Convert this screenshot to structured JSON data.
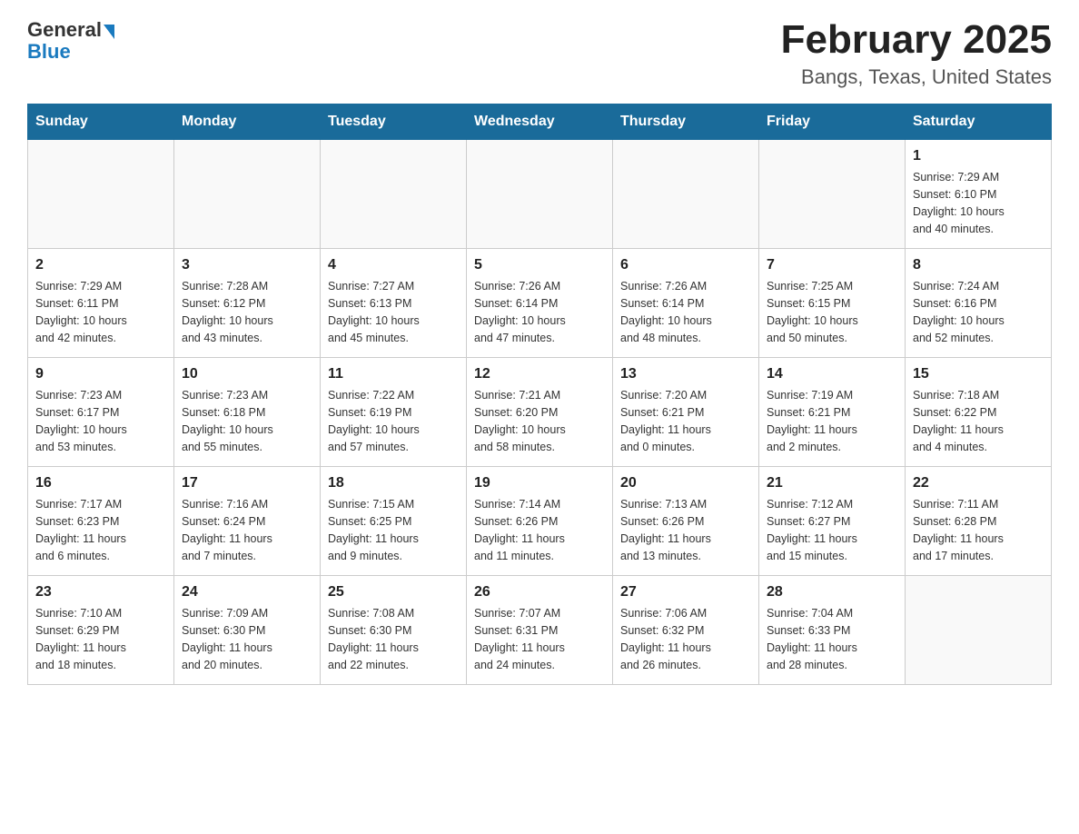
{
  "header": {
    "logo_general": "General",
    "logo_blue": "Blue",
    "month_title": "February 2025",
    "location": "Bangs, Texas, United States"
  },
  "days_of_week": [
    "Sunday",
    "Monday",
    "Tuesday",
    "Wednesday",
    "Thursday",
    "Friday",
    "Saturday"
  ],
  "weeks": [
    {
      "days": [
        {
          "number": "",
          "info": ""
        },
        {
          "number": "",
          "info": ""
        },
        {
          "number": "",
          "info": ""
        },
        {
          "number": "",
          "info": ""
        },
        {
          "number": "",
          "info": ""
        },
        {
          "number": "",
          "info": ""
        },
        {
          "number": "1",
          "info": "Sunrise: 7:29 AM\nSunset: 6:10 PM\nDaylight: 10 hours\nand 40 minutes."
        }
      ]
    },
    {
      "days": [
        {
          "number": "2",
          "info": "Sunrise: 7:29 AM\nSunset: 6:11 PM\nDaylight: 10 hours\nand 42 minutes."
        },
        {
          "number": "3",
          "info": "Sunrise: 7:28 AM\nSunset: 6:12 PM\nDaylight: 10 hours\nand 43 minutes."
        },
        {
          "number": "4",
          "info": "Sunrise: 7:27 AM\nSunset: 6:13 PM\nDaylight: 10 hours\nand 45 minutes."
        },
        {
          "number": "5",
          "info": "Sunrise: 7:26 AM\nSunset: 6:14 PM\nDaylight: 10 hours\nand 47 minutes."
        },
        {
          "number": "6",
          "info": "Sunrise: 7:26 AM\nSunset: 6:14 PM\nDaylight: 10 hours\nand 48 minutes."
        },
        {
          "number": "7",
          "info": "Sunrise: 7:25 AM\nSunset: 6:15 PM\nDaylight: 10 hours\nand 50 minutes."
        },
        {
          "number": "8",
          "info": "Sunrise: 7:24 AM\nSunset: 6:16 PM\nDaylight: 10 hours\nand 52 minutes."
        }
      ]
    },
    {
      "days": [
        {
          "number": "9",
          "info": "Sunrise: 7:23 AM\nSunset: 6:17 PM\nDaylight: 10 hours\nand 53 minutes."
        },
        {
          "number": "10",
          "info": "Sunrise: 7:23 AM\nSunset: 6:18 PM\nDaylight: 10 hours\nand 55 minutes."
        },
        {
          "number": "11",
          "info": "Sunrise: 7:22 AM\nSunset: 6:19 PM\nDaylight: 10 hours\nand 57 minutes."
        },
        {
          "number": "12",
          "info": "Sunrise: 7:21 AM\nSunset: 6:20 PM\nDaylight: 10 hours\nand 58 minutes."
        },
        {
          "number": "13",
          "info": "Sunrise: 7:20 AM\nSunset: 6:21 PM\nDaylight: 11 hours\nand 0 minutes."
        },
        {
          "number": "14",
          "info": "Sunrise: 7:19 AM\nSunset: 6:21 PM\nDaylight: 11 hours\nand 2 minutes."
        },
        {
          "number": "15",
          "info": "Sunrise: 7:18 AM\nSunset: 6:22 PM\nDaylight: 11 hours\nand 4 minutes."
        }
      ]
    },
    {
      "days": [
        {
          "number": "16",
          "info": "Sunrise: 7:17 AM\nSunset: 6:23 PM\nDaylight: 11 hours\nand 6 minutes."
        },
        {
          "number": "17",
          "info": "Sunrise: 7:16 AM\nSunset: 6:24 PM\nDaylight: 11 hours\nand 7 minutes."
        },
        {
          "number": "18",
          "info": "Sunrise: 7:15 AM\nSunset: 6:25 PM\nDaylight: 11 hours\nand 9 minutes."
        },
        {
          "number": "19",
          "info": "Sunrise: 7:14 AM\nSunset: 6:26 PM\nDaylight: 11 hours\nand 11 minutes."
        },
        {
          "number": "20",
          "info": "Sunrise: 7:13 AM\nSunset: 6:26 PM\nDaylight: 11 hours\nand 13 minutes."
        },
        {
          "number": "21",
          "info": "Sunrise: 7:12 AM\nSunset: 6:27 PM\nDaylight: 11 hours\nand 15 minutes."
        },
        {
          "number": "22",
          "info": "Sunrise: 7:11 AM\nSunset: 6:28 PM\nDaylight: 11 hours\nand 17 minutes."
        }
      ]
    },
    {
      "days": [
        {
          "number": "23",
          "info": "Sunrise: 7:10 AM\nSunset: 6:29 PM\nDaylight: 11 hours\nand 18 minutes."
        },
        {
          "number": "24",
          "info": "Sunrise: 7:09 AM\nSunset: 6:30 PM\nDaylight: 11 hours\nand 20 minutes."
        },
        {
          "number": "25",
          "info": "Sunrise: 7:08 AM\nSunset: 6:30 PM\nDaylight: 11 hours\nand 22 minutes."
        },
        {
          "number": "26",
          "info": "Sunrise: 7:07 AM\nSunset: 6:31 PM\nDaylight: 11 hours\nand 24 minutes."
        },
        {
          "number": "27",
          "info": "Sunrise: 7:06 AM\nSunset: 6:32 PM\nDaylight: 11 hours\nand 26 minutes."
        },
        {
          "number": "28",
          "info": "Sunrise: 7:04 AM\nSunset: 6:33 PM\nDaylight: 11 hours\nand 28 minutes."
        },
        {
          "number": "",
          "info": ""
        }
      ]
    }
  ]
}
